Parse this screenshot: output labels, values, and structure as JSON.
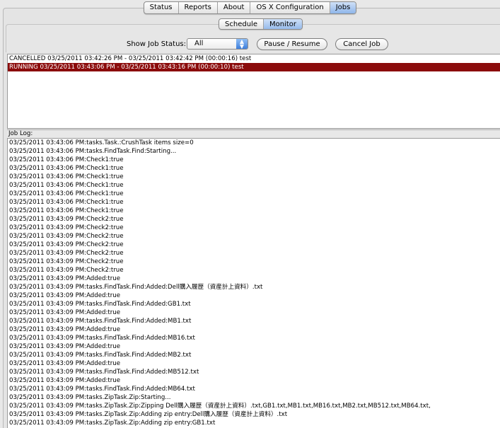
{
  "top_tabs": [
    {
      "label": "Status",
      "active": false
    },
    {
      "label": "Reports",
      "active": false
    },
    {
      "label": "About",
      "active": false
    },
    {
      "label": "OS X Configuration",
      "active": false
    },
    {
      "label": "Jobs",
      "active": true
    }
  ],
  "sub_tabs": [
    {
      "label": "Schedule",
      "active": false
    },
    {
      "label": "Monitor",
      "active": true
    }
  ],
  "controls": {
    "status_label": "Show Job Status:",
    "status_selected": "All",
    "pause_label": "Pause / Resume",
    "cancel_label": "Cancel Job"
  },
  "colors": {
    "running_row_bg": "#8b0b0b",
    "active_tab": "#8fb6ea"
  },
  "jobs": [
    {
      "text": "CANCELLED 03/25/2011 03:42:26 PM - 03/25/2011 03:42:42 PM (00:00:16) test",
      "state": "cancelled"
    },
    {
      "text": "RUNNING 03/25/2011 03:43:06 PM - 03/25/2011 03:43:16 PM (00:00:10) test",
      "state": "running"
    }
  ],
  "log_label": "Job Log:",
  "log_lines": [
    "03/25/2011 03:43:06 PM:tasks.Task.:CrushTask items size=0",
    "03/25/2011 03:43:06 PM:tasks.FindTask.Find:Starting...",
    "03/25/2011 03:43:06 PM:Check1:true",
    "03/25/2011 03:43:06 PM:Check1:true",
    "03/25/2011 03:43:06 PM:Check1:true",
    "03/25/2011 03:43:06 PM:Check1:true",
    "03/25/2011 03:43:06 PM:Check1:true",
    "03/25/2011 03:43:06 PM:Check1:true",
    "03/25/2011 03:43:06 PM:Check1:true",
    "03/25/2011 03:43:09 PM:Check2:true",
    "03/25/2011 03:43:09 PM:Check2:true",
    "03/25/2011 03:43:09 PM:Check2:true",
    "03/25/2011 03:43:09 PM:Check2:true",
    "03/25/2011 03:43:09 PM:Check2:true",
    "03/25/2011 03:43:09 PM:Check2:true",
    "03/25/2011 03:43:09 PM:Check2:true",
    "03/25/2011 03:43:09 PM:Added:true",
    "03/25/2011 03:43:09 PM:tasks.FindTask.Find:Added:Dell購入履歴（資産計上資料）.txt",
    "03/25/2011 03:43:09 PM:Added:true",
    "03/25/2011 03:43:09 PM:tasks.FindTask.Find:Added:GB1.txt",
    "03/25/2011 03:43:09 PM:Added:true",
    "03/25/2011 03:43:09 PM:tasks.FindTask.Find:Added:MB1.txt",
    "03/25/2011 03:43:09 PM:Added:true",
    "03/25/2011 03:43:09 PM:tasks.FindTask.Find:Added:MB16.txt",
    "03/25/2011 03:43:09 PM:Added:true",
    "03/25/2011 03:43:09 PM:tasks.FindTask.Find:Added:MB2.txt",
    "03/25/2011 03:43:09 PM:Added:true",
    "03/25/2011 03:43:09 PM:tasks.FindTask.Find:Added:MB512.txt",
    "03/25/2011 03:43:09 PM:Added:true",
    "03/25/2011 03:43:09 PM:tasks.FindTask.Find:Added:MB64.txt",
    "03/25/2011 03:43:09 PM:tasks.ZipTask.Zip:Starting...",
    "03/25/2011 03:43:09 PM:tasks.ZipTask.Zip:Zipping Dell購入履歴（資産計上資料）.txt,GB1.txt,MB1.txt,MB16.txt,MB2.txt,MB512.txt,MB64.txt,",
    "03/25/2011 03:43:09 PM:tasks.ZipTask.Zip:Adding zip entry:Dell購入履歴（資産計上資料）.txt",
    "03/25/2011 03:43:09 PM:tasks.ZipTask.Zip:Adding zip entry:GB1.txt"
  ]
}
